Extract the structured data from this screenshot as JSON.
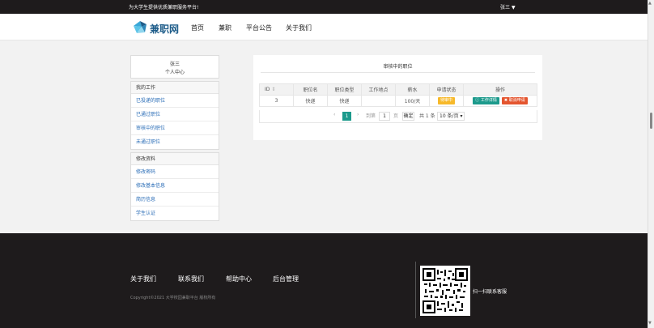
{
  "topbar": {
    "slogan": "为大学生提供优质兼职服务平台!",
    "username": "张三"
  },
  "header": {
    "logo_text": "兼职网",
    "nav": [
      "首页",
      "兼职",
      "平台公告",
      "关于我们"
    ]
  },
  "sidebar": {
    "profile_name": "张三",
    "profile_center": "个人中心",
    "group1": {
      "title": "我的工作",
      "items": [
        "已投递的职位",
        "已通过职位",
        "审核中的职位",
        "未通过职位"
      ]
    },
    "group2": {
      "title": "修改资料",
      "items": [
        "修改密码",
        "修改基本信息",
        "简历信息",
        "学生认证"
      ]
    }
  },
  "main": {
    "title": "审核中的职位",
    "columns": [
      "ID",
      "职位名",
      "职位类型",
      "工作地点",
      "薪水",
      "申请状态",
      "操作"
    ],
    "rows": [
      {
        "id": "3",
        "name": "快递",
        "type": "快递",
        "location": "",
        "salary": "100/天",
        "status": "待审中",
        "action_detail": "工作详情",
        "action_cancel": "取消申请"
      }
    ],
    "pager": {
      "current_page": "1",
      "goto_label": "到第",
      "goto_value": "1",
      "page_unit": "页",
      "confirm": "确定",
      "total": "共 1 条",
      "page_size": "10 条/页"
    }
  },
  "footer": {
    "links": [
      "关于我们",
      "联系我们",
      "帮助中心",
      "后台管理"
    ],
    "copyright": "Copyright©2021 大学校园兼职平台 版权所有",
    "qr_label": "扫一扫联系客服"
  },
  "colors": {
    "dark_bg": "#1e1b1c",
    "accent_teal": "#1c9a8c",
    "status_pending": "#f7b92a",
    "cancel_red": "#e4552f",
    "link_blue": "#2a6db7"
  }
}
